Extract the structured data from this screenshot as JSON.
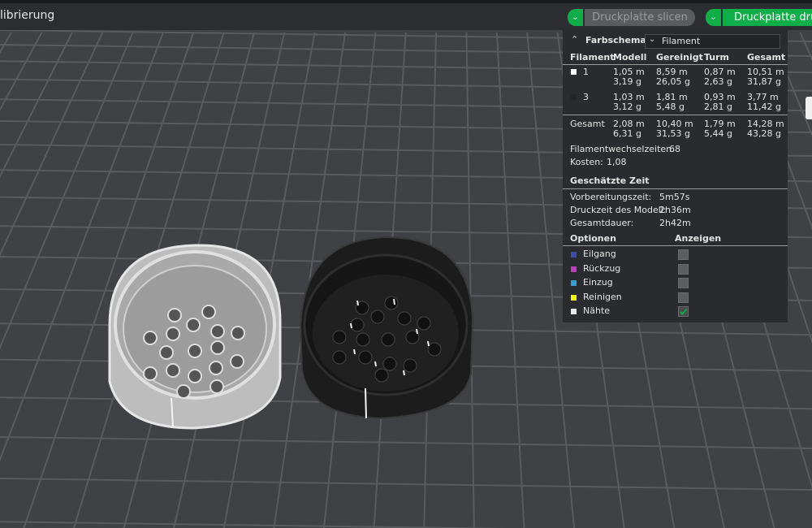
{
  "window": {
    "tab_title": "librierung"
  },
  "toolbar": {
    "slice_label": "Druckplatte slicen",
    "print_label": "Druckplatte drucken",
    "accent": "#0fae48"
  },
  "panel": {
    "color_scheme_label": "Farbschema",
    "color_scheme_value": "Filament",
    "columns": [
      "Filament",
      "Modell",
      "Gereinigt",
      "Turm",
      "Gesamt"
    ],
    "rows": [
      {
        "filament": "1",
        "color": "#ffffff",
        "modell": [
          "1,05 m",
          "3,19 g"
        ],
        "gereinigt": [
          "8,59 m",
          "26,05 g"
        ],
        "turm": [
          "0,87 m",
          "2,63 g"
        ],
        "gesamt": [
          "10,51 m",
          "31,87 g"
        ]
      },
      {
        "filament": "3",
        "color": "#262626",
        "modell": [
          "1,03 m",
          "3,12 g"
        ],
        "gereinigt": [
          "1,81 m",
          "5,48 g"
        ],
        "turm": [
          "0,93 m",
          "2,81 g"
        ],
        "gesamt": [
          "3,77 m",
          "11,42 g"
        ]
      }
    ],
    "total": {
      "label": "Gesamt",
      "modell": [
        "2,08 m",
        "6,31 g"
      ],
      "gereinigt": [
        "10,40 m",
        "31,53 g"
      ],
      "turm": [
        "1,79 m",
        "5,44 g"
      ],
      "gesamt": [
        "14,28 m",
        "43,28 g"
      ]
    },
    "filament_changes_label": "Filamentwechselzeiten:",
    "filament_changes_value": "68",
    "cost_label": "Kosten:",
    "cost_value": "1,08",
    "time_header": "Geschätzte Zeit",
    "times": [
      {
        "label": "Vorbereitungszeit:",
        "value": "5m57s"
      },
      {
        "label": "Druckzeit des Modell:",
        "value": "2h36m"
      },
      {
        "label": "Gesamtdauer:",
        "value": "2h42m"
      }
    ],
    "options_header": "Optionen",
    "show_header": "Anzeigen",
    "options": [
      {
        "label": "Eilgang",
        "color": "#3b4db0",
        "checked": false
      },
      {
        "label": "Rückzug",
        "color": "#c03cc0",
        "checked": false
      },
      {
        "label": "Einzug",
        "color": "#2f9fd6",
        "checked": false
      },
      {
        "label": "Reinigen",
        "color": "#f2f20a",
        "checked": false
      },
      {
        "label": "Nähte",
        "color": "#e8e8e8",
        "checked": true
      }
    ]
  }
}
